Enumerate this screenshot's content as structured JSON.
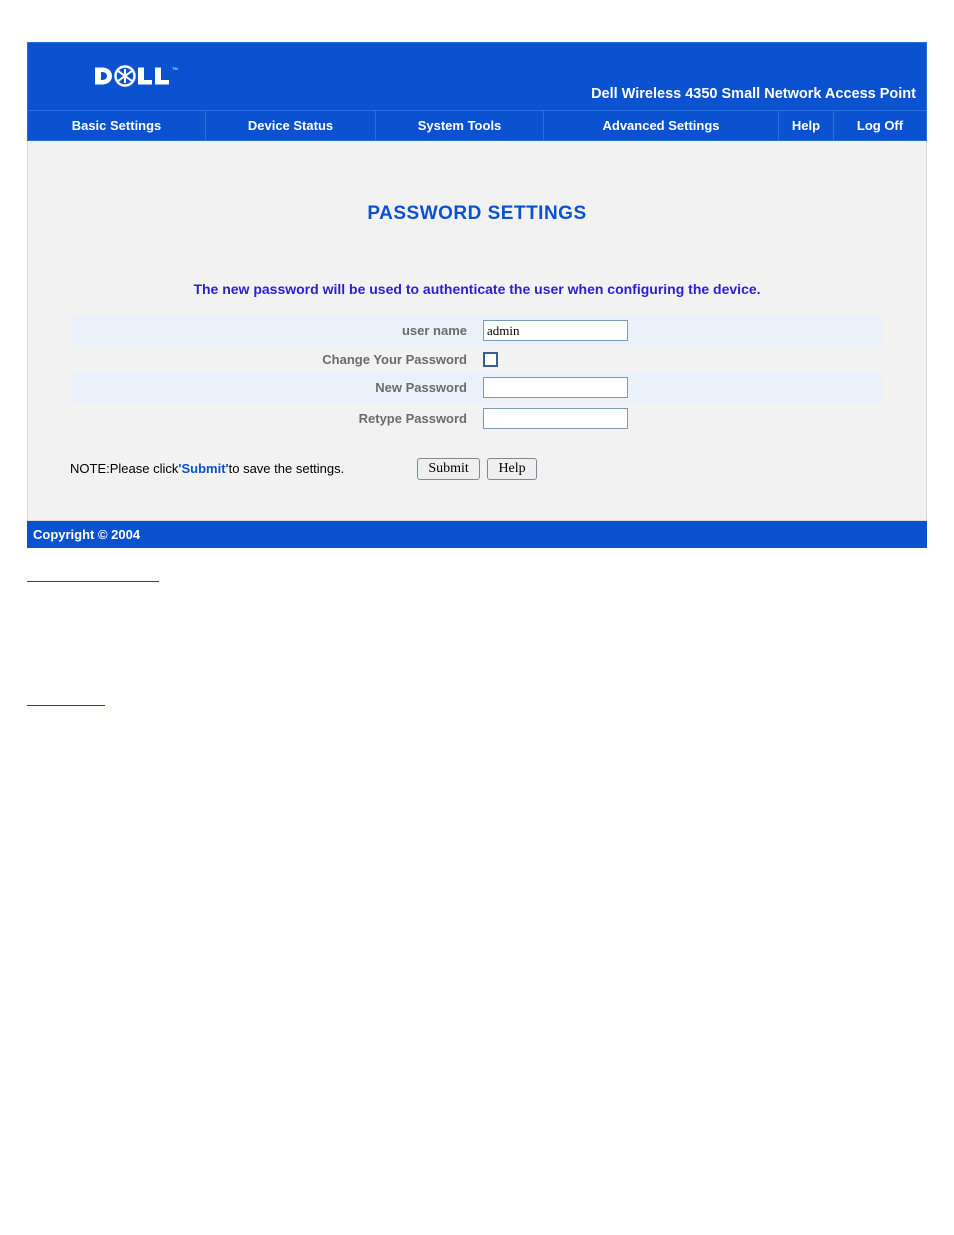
{
  "header": {
    "device_title": "Dell Wireless 4350 Small Network Access Point"
  },
  "nav": {
    "basic": "Basic Settings",
    "status": "Device Status",
    "tools": "System Tools",
    "advanced": "Advanced Settings",
    "help": "Help",
    "logoff": "Log Off"
  },
  "main": {
    "title": "PASSWORD SETTINGS",
    "instruction": "The new password will be used to authenticate the user when configuring the device.",
    "fields": {
      "username_label": "user name",
      "username_value": "admin",
      "change_pw_label": "Change Your Password",
      "new_pw_label": "New Password",
      "retype_pw_label": "Retype Password"
    },
    "buttons": {
      "submit": "Submit",
      "help": "Help"
    },
    "note_prefix": "NOTE:Please click",
    "note_bold": "'Submit'",
    "note_suffix": "to save the settings."
  },
  "footer": {
    "copyright": "Copyright © 2004"
  }
}
